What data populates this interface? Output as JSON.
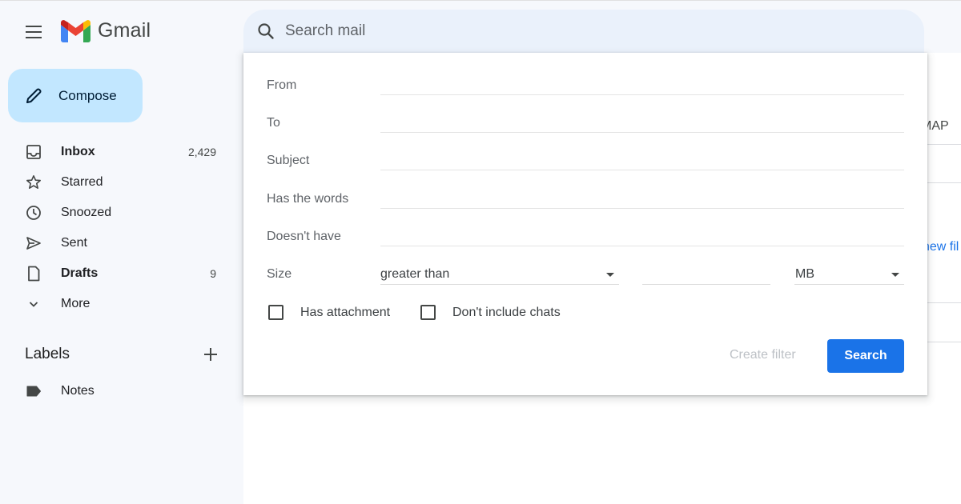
{
  "app": {
    "name": "Gmail",
    "colors": {
      "accent": "#1a73e8",
      "compose_bg": "#c2e7ff",
      "search_bg": "#eaf1fb"
    }
  },
  "header": {
    "menu_icon": "hamburger-menu-icon",
    "logo_icon": "gmail-m-logo",
    "search_placeholder": "Search mail",
    "search_icon": "search-icon"
  },
  "sidebar": {
    "compose_label": "Compose",
    "items": [
      {
        "label": "Inbox",
        "count": "2,429",
        "icon": "inbox-icon",
        "bold": true
      },
      {
        "label": "Starred",
        "count": "",
        "icon": "star-icon",
        "bold": false
      },
      {
        "label": "Snoozed",
        "count": "",
        "icon": "clock-icon",
        "bold": false
      },
      {
        "label": "Sent",
        "count": "",
        "icon": "send-icon",
        "bold": false
      },
      {
        "label": "Drafts",
        "count": "9",
        "icon": "draft-icon",
        "bold": true
      },
      {
        "label": "More",
        "count": "",
        "icon": "chevron-down-icon",
        "bold": false
      }
    ],
    "labels_title": "Labels",
    "labels": [
      {
        "label": "Notes",
        "icon": "label-tag-icon"
      }
    ]
  },
  "background_peek": {
    "tab_fragment": "MAP",
    "link_fragment": "new fil"
  },
  "advanced_search": {
    "fields": [
      {
        "label": "From",
        "value": ""
      },
      {
        "label": "To",
        "value": ""
      },
      {
        "label": "Subject",
        "value": ""
      },
      {
        "label": "Has the words",
        "value": ""
      },
      {
        "label": "Doesn't have",
        "value": ""
      }
    ],
    "size_label": "Size",
    "size_operator": "greater than",
    "size_value": "",
    "size_unit": "MB",
    "has_attachment_label": "Has attachment",
    "has_attachment_checked": false,
    "exclude_chats_label": "Don't include chats",
    "exclude_chats_checked": false,
    "create_filter_label": "Create filter",
    "search_button_label": "Search"
  }
}
